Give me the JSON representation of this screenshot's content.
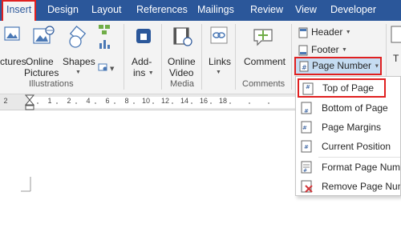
{
  "tabs": [
    {
      "label": "Insert",
      "active": true
    },
    {
      "label": "Design"
    },
    {
      "label": "Layout"
    },
    {
      "label": "References"
    },
    {
      "label": "Mailings"
    },
    {
      "label": "Review"
    },
    {
      "label": "View"
    },
    {
      "label": "Developer"
    }
  ],
  "ribbon": {
    "illustrations": {
      "pictures": "ctures",
      "online_pictures_1": "Online",
      "online_pictures_2": "Pictures",
      "shapes": "Shapes",
      "group_label": "Illustrations"
    },
    "addins": {
      "line1": "Add-",
      "line2": "ins"
    },
    "media": {
      "online_video_1": "Online",
      "online_video_2": "Video",
      "group_label": "Media"
    },
    "links": {
      "label": "Links"
    },
    "comments": {
      "comment": "Comment",
      "group_label": "Comments"
    },
    "header_footer": {
      "header": "Header",
      "footer": "Footer",
      "page_number": "Page Number"
    },
    "text_partial": "T"
  },
  "ruler": {
    "ticks": [
      "2",
      "1",
      "2",
      "4",
      "6",
      "8",
      "10",
      "12",
      "14",
      "16",
      "18"
    ]
  },
  "page_number_menu": {
    "items": [
      {
        "label": "Top of Page",
        "icon": "page-top-icon",
        "highlighted": true
      },
      {
        "label": "Bottom of Page",
        "icon": "page-bottom-icon"
      },
      {
        "label": "Page Margins",
        "icon": "page-margins-icon"
      },
      {
        "label": "Current Position",
        "icon": "current-position-icon"
      },
      {
        "label": "Format Page Numb",
        "icon": "format-page-number-icon"
      },
      {
        "label": "Remove Page Num",
        "icon": "remove-page-number-icon"
      }
    ]
  },
  "colors": {
    "ribbon_blue": "#2b579a",
    "highlight_red": "#e02020"
  }
}
